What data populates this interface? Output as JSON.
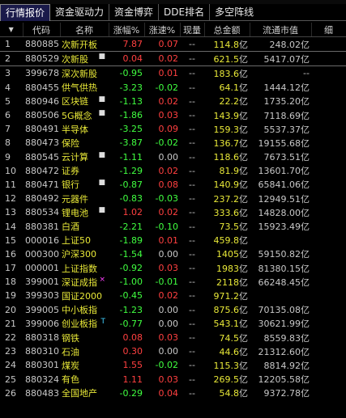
{
  "tabs": [
    "行情报价",
    "资金驱动力",
    "资金博弈",
    "DDE排名",
    "多空阵线"
  ],
  "columns": {
    "sort_icon": "▼",
    "code": "代码",
    "name": "名称",
    "pct": "涨幅%",
    "speed": "涨速%",
    "now": "现量",
    "amount": "总金额",
    "cap": "流通市值",
    "more": "细"
  },
  "unit": "亿",
  "rows": [
    {
      "idx": "1",
      "code": "880885",
      "name": "次新开板",
      "mark": "",
      "pct": "7.87",
      "speed": "0.07",
      "now": "--",
      "amount": "114.8",
      "cap": "248.02"
    },
    {
      "idx": "2",
      "code": "880529",
      "name": "次新股",
      "mark": "■",
      "pct": "0.04",
      "speed": "0.02",
      "now": "--",
      "amount": "621.5",
      "cap": "5417.07"
    },
    {
      "idx": "3",
      "code": "399678",
      "name": "深次新股",
      "mark": "",
      "pct": "-0.95",
      "speed": "0.01",
      "now": "--",
      "amount": "183.6",
      "cap": "--"
    },
    {
      "idx": "4",
      "code": "880455",
      "name": "供气供热",
      "mark": "",
      "pct": "-3.23",
      "speed": "-0.02",
      "now": "--",
      "amount": "64.1",
      "cap": "1444.12"
    },
    {
      "idx": "5",
      "code": "880946",
      "name": "区块链",
      "mark": "■",
      "pct": "-1.13",
      "speed": "0.02",
      "now": "--",
      "amount": "22.2",
      "cap": "1735.20"
    },
    {
      "idx": "6",
      "code": "880506",
      "name": "5G概念",
      "mark": "■",
      "pct": "-1.86",
      "speed": "0.03",
      "now": "--",
      "amount": "143.9",
      "cap": "7118.69"
    },
    {
      "idx": "7",
      "code": "880491",
      "name": "半导体",
      "mark": "",
      "pct": "-3.25",
      "speed": "0.09",
      "now": "--",
      "amount": "159.3",
      "cap": "5537.37"
    },
    {
      "idx": "8",
      "code": "880473",
      "name": "保险",
      "mark": "",
      "pct": "-3.87",
      "speed": "-0.02",
      "now": "--",
      "amount": "136.7",
      "cap": "19155.68"
    },
    {
      "idx": "9",
      "code": "880545",
      "name": "云计算",
      "mark": "■",
      "pct": "-1.11",
      "speed": "0.00",
      "now": "--",
      "amount": "118.6",
      "cap": "7673.51"
    },
    {
      "idx": "10",
      "code": "880472",
      "name": "证券",
      "mark": "",
      "pct": "-1.29",
      "speed": "0.02",
      "now": "--",
      "amount": "81.9",
      "cap": "13601.70"
    },
    {
      "idx": "11",
      "code": "880471",
      "name": "银行",
      "mark": "■",
      "pct": "-0.87",
      "speed": "0.08",
      "now": "--",
      "amount": "140.9",
      "cap": "65841.06"
    },
    {
      "idx": "12",
      "code": "880492",
      "name": "元器件",
      "mark": "",
      "pct": "-0.83",
      "speed": "-0.03",
      "now": "--",
      "amount": "237.2",
      "cap": "12949.51"
    },
    {
      "idx": "13",
      "code": "880534",
      "name": "锂电池",
      "mark": "■",
      "pct": "1.02",
      "speed": "0.02",
      "now": "--",
      "amount": "333.6",
      "cap": "14828.00"
    },
    {
      "idx": "14",
      "code": "880381",
      "name": "白酒",
      "mark": "",
      "pct": "-2.21",
      "speed": "-0.10",
      "now": "--",
      "amount": "73.5",
      "cap": "15923.49"
    },
    {
      "idx": "15",
      "code": "000016",
      "name": "上证50",
      "mark": "",
      "pct": "-1.89",
      "speed": "0.01",
      "now": "--",
      "amount": "459.8",
      "cap": ""
    },
    {
      "idx": "16",
      "code": "000300",
      "name": "沪深300",
      "mark": "",
      "pct": "-1.54",
      "speed": "0.00",
      "now": "--",
      "amount": "1405",
      "cap": "59150.82"
    },
    {
      "idx": "17",
      "code": "000001",
      "name": "上证指数",
      "mark": "",
      "pct": "-0.92",
      "speed": "0.03",
      "now": "--",
      "amount": "1983",
      "cap": "81380.15"
    },
    {
      "idx": "18",
      "code": "399001",
      "name": "深证成指",
      "mark": "×",
      "markClass": "magenta",
      "pct": "-1.00",
      "speed": "-0.01",
      "now": "--",
      "amount": "2118",
      "cap": "66248.45"
    },
    {
      "idx": "19",
      "code": "399303",
      "name": "国证2000",
      "mark": "",
      "pct": "-0.45",
      "speed": "0.02",
      "now": "--",
      "amount": "971.2",
      "cap": ""
    },
    {
      "idx": "20",
      "code": "399005",
      "name": "中小板指",
      "mark": "",
      "pct": "-1.23",
      "speed": "0.00",
      "now": "--",
      "amount": "875.6",
      "cap": "70135.08"
    },
    {
      "idx": "21",
      "code": "399006",
      "name": "创业板指",
      "mark": "T",
      "markClass": "cyan",
      "pct": "-0.77",
      "speed": "0.00",
      "now": "--",
      "amount": "543.1",
      "cap": "30621.99"
    },
    {
      "idx": "22",
      "code": "880318",
      "name": "钢铁",
      "mark": "",
      "pct": "0.08",
      "speed": "0.03",
      "now": "--",
      "amount": "74.5",
      "cap": "8559.83"
    },
    {
      "idx": "23",
      "code": "880310",
      "name": "石油",
      "mark": "",
      "pct": "0.30",
      "speed": "0.00",
      "now": "--",
      "amount": "44.6",
      "cap": "21312.60"
    },
    {
      "idx": "24",
      "code": "880301",
      "name": "煤炭",
      "mark": "",
      "pct": "1.55",
      "speed": "-0.02",
      "now": "--",
      "amount": "115.3",
      "cap": "8814.92"
    },
    {
      "idx": "25",
      "code": "880324",
      "name": "有色",
      "mark": "",
      "pct": "1.11",
      "speed": "0.03",
      "now": "--",
      "amount": "269.5",
      "cap": "12205.58"
    },
    {
      "idx": "26",
      "code": "880483",
      "name": "全国地产",
      "mark": "",
      "pct": "-0.29",
      "speed": "0.04",
      "now": "--",
      "amount": "54.8",
      "cap": "9372.78"
    }
  ],
  "colors": {
    "up": "#ff4040",
    "down": "#40ff40",
    "name": "#e8e838",
    "background": "#000000"
  }
}
